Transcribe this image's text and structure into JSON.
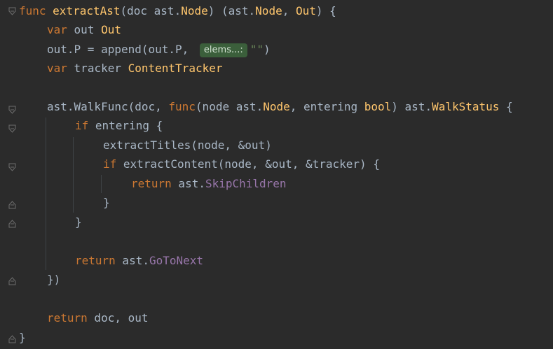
{
  "code": {
    "line1": {
      "kw": "func",
      "name": "extractAst",
      "params": "(doc ast.",
      "type1": "Node",
      "rest": ") (ast.",
      "type2": "Node",
      "comma": ", ",
      "type3": "Out",
      "end": ") {"
    },
    "line2": {
      "kw": "var",
      "name": "out",
      "type": "Out"
    },
    "line3": {
      "pre": "out.P = append(out.P, ",
      "hint": "elems...:",
      "str": "\"\"",
      "end": ")"
    },
    "line4": {
      "kw": "var",
      "name": "tracker",
      "type": "ContentTracker"
    },
    "line6": {
      "pre": "ast.WalkFunc(doc, ",
      "kw": "func",
      "mid1": "(node ast.",
      "type1": "Node",
      "mid2": ", entering ",
      "type2": "bool",
      "mid3": ") ast.",
      "type3": "WalkStatus",
      "end": " {"
    },
    "line7": {
      "kw": "if",
      "rest": " entering {"
    },
    "line8": {
      "text": "extractTitles(node, &out)"
    },
    "line9": {
      "kw": "if",
      "rest": " extractContent(node, &out, &tracker) {"
    },
    "line10": {
      "kw": "return",
      "pre": " ast.",
      "const": "SkipChildren"
    },
    "line11": {
      "text": "}"
    },
    "line12": {
      "text": "}"
    },
    "line14": {
      "kw": "return",
      "pre": " ast.",
      "const": "GoToNext"
    },
    "line15": {
      "text": "})"
    },
    "line17": {
      "kw": "return",
      "rest": " doc, out"
    },
    "line18": {
      "text": "}"
    }
  }
}
